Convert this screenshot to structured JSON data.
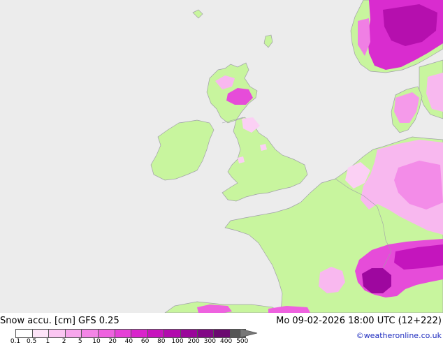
{
  "header": {
    "left_title": "Snow accu. [cm] GFS 0.25",
    "right_title": "Mo 09-02-2026 18:00 UTC (12+222)"
  },
  "legend": {
    "ticks": [
      "0.1",
      "0.5",
      "1",
      "2",
      "5",
      "10",
      "20",
      "40",
      "60",
      "80",
      "100",
      "200",
      "300",
      "400",
      "500"
    ],
    "colors": [
      "#ffffff",
      "#fde4f8",
      "#fbc6f2",
      "#f7a6ec",
      "#f385e6",
      "#ee62df",
      "#e640d7",
      "#d924cc",
      "#c713bd",
      "#b20aad",
      "#9a069a",
      "#820886",
      "#6b0a70",
      "#555555",
      "#777777"
    ]
  },
  "credit": "©weatheronline.co.uk",
  "map_colors": {
    "sea": "#ececec",
    "land": "#c8f59e",
    "coast": "#a0a0a8"
  }
}
